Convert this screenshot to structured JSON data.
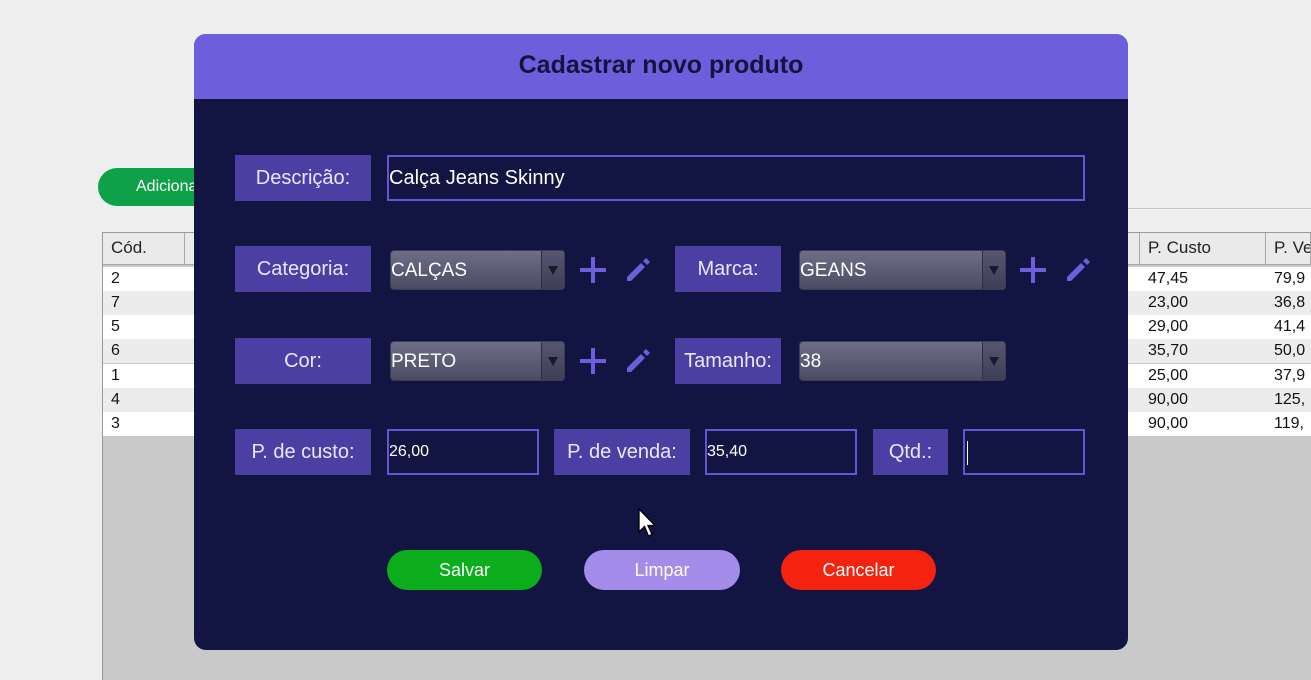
{
  "background": {
    "add_button_label": "Adicionar",
    "table": {
      "columns": [
        "Cód.",
        "P. Custo",
        "P. Venda"
      ],
      "rows": [
        {
          "cod": "2",
          "custo": "47,45",
          "venda": "79,9"
        },
        {
          "cod": "7",
          "custo": "23,00",
          "venda": "36,8"
        },
        {
          "cod": "5",
          "custo": "29,00",
          "venda": "41,4"
        },
        {
          "cod": "6",
          "custo": "35,70",
          "venda": "50,0"
        },
        {
          "cod": "1",
          "custo": "25,00",
          "venda": "37,9"
        },
        {
          "cod": "4",
          "custo": "90,00",
          "venda": "125,"
        },
        {
          "cod": "3",
          "custo": "90,00",
          "venda": "119,"
        }
      ]
    }
  },
  "modal": {
    "title": "Cadastrar novo produto",
    "descricao": {
      "label": "Descrição:",
      "value": "Calça Jeans Skinny"
    },
    "categoria": {
      "label": "Categoria:",
      "value": "CALÇAS"
    },
    "marca": {
      "label": "Marca:",
      "value": "GEANS"
    },
    "cor": {
      "label": "Cor:",
      "value": "PRETO"
    },
    "tamanho": {
      "label": "Tamanho:",
      "value": "38"
    },
    "preco_custo": {
      "label": "P. de custo:",
      "value": "26,00"
    },
    "preco_venda": {
      "label": "P. de venda:",
      "value": "35,40"
    },
    "quantidade": {
      "label": "Qtd.:",
      "value": ""
    },
    "buttons": {
      "save": "Salvar",
      "clear": "Limpar",
      "cancel": "Cancelar"
    }
  },
  "colors": {
    "modal_bg": "#121442",
    "header_bg": "#6d5fdb",
    "label_bg": "#4b3fa3",
    "save": "#0bad1c",
    "clear": "#a48ceb",
    "cancel": "#f5220f",
    "icon": "#6d5fdb"
  },
  "icons": [
    "plus-icon",
    "pencil-icon",
    "chevron-down-icon",
    "mouse-cursor-icon"
  ]
}
